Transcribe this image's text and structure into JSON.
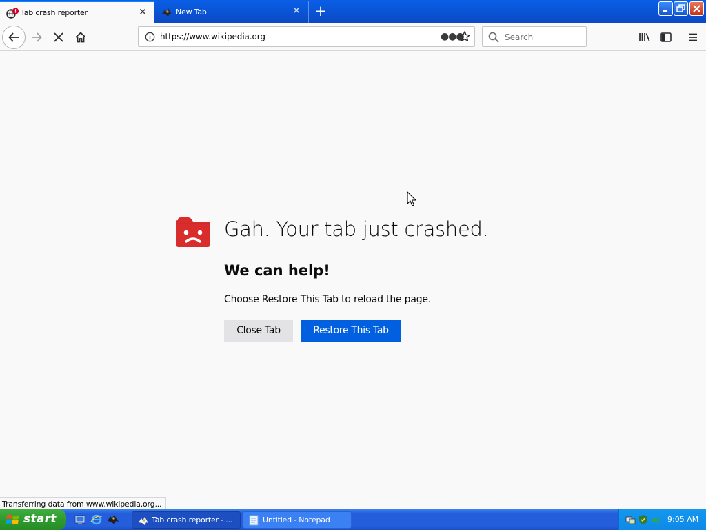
{
  "browser": {
    "tabs": [
      {
        "label": "Tab crash reporter",
        "active": true
      },
      {
        "label": "New Tab",
        "active": false
      }
    ],
    "url": "https://www.wikipedia.org",
    "search_placeholder": "Search",
    "status_text": "Transferring data from www.wikipedia.org..."
  },
  "page": {
    "title": "Gah. Your tab just crashed.",
    "subtitle": "We can help!",
    "description": "Choose Restore This Tab to reload the page.",
    "close_tab_label": "Close Tab",
    "restore_label": "Restore This Tab"
  },
  "taskbar": {
    "start_label": "start",
    "tasks": [
      {
        "label": "Tab crash reporter - ...",
        "active": true
      },
      {
        "label": "Untitled - Notepad",
        "active": false
      }
    ],
    "clock": "9:05 AM"
  },
  "colors": {
    "accent": "#0060df",
    "crash_red": "#d92d2d",
    "xp_blue": "#245edb",
    "start_green": "#2f9a2f"
  }
}
